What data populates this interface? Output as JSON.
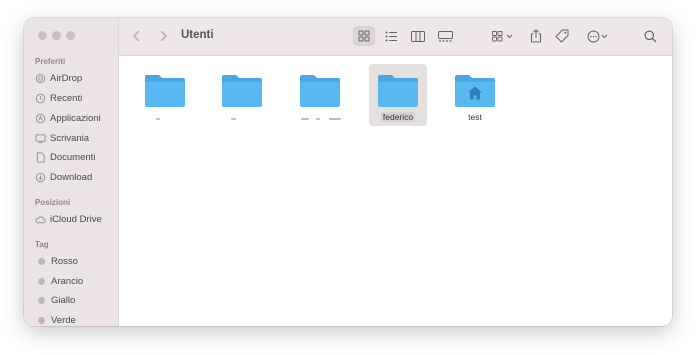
{
  "window": {
    "title": "Utenti"
  },
  "sidebar": {
    "favorites_header": "Preferiti",
    "favorites": [
      {
        "label": "AirDrop",
        "icon": "airdrop-icon"
      },
      {
        "label": "Recenti",
        "icon": "clock-icon"
      },
      {
        "label": "Applicazioni",
        "icon": "applications-icon"
      },
      {
        "label": "Scrivania",
        "icon": "desktop-icon"
      },
      {
        "label": "Documenti",
        "icon": "document-icon"
      },
      {
        "label": "Download",
        "icon": "download-icon"
      }
    ],
    "locations_header": "Posizioni",
    "locations": [
      {
        "label": "iCloud Drive",
        "icon": "cloud-icon"
      }
    ],
    "tags_header": "Tag",
    "tags": [
      {
        "label": "Rosso",
        "color": "#bdb7b7"
      },
      {
        "label": "Arancio",
        "color": "#bdb7b7"
      },
      {
        "label": "Giallo",
        "color": "#bdb7b7"
      },
      {
        "label": "Verde",
        "color": "#bdb7b7"
      }
    ]
  },
  "files": [
    {
      "label": "",
      "icon": "folder-icon"
    },
    {
      "label": "",
      "icon": "folder-icon"
    },
    {
      "label": "",
      "icon": "folder-icon"
    },
    {
      "label": "federico",
      "icon": "folder-icon",
      "selected": true
    },
    {
      "label": "test",
      "icon": "home-folder-icon"
    }
  ],
  "colors": {
    "folder": "#5ab8f0",
    "folder_tab": "#4aa8e0",
    "sidebar_bg": "#ece4e4"
  }
}
